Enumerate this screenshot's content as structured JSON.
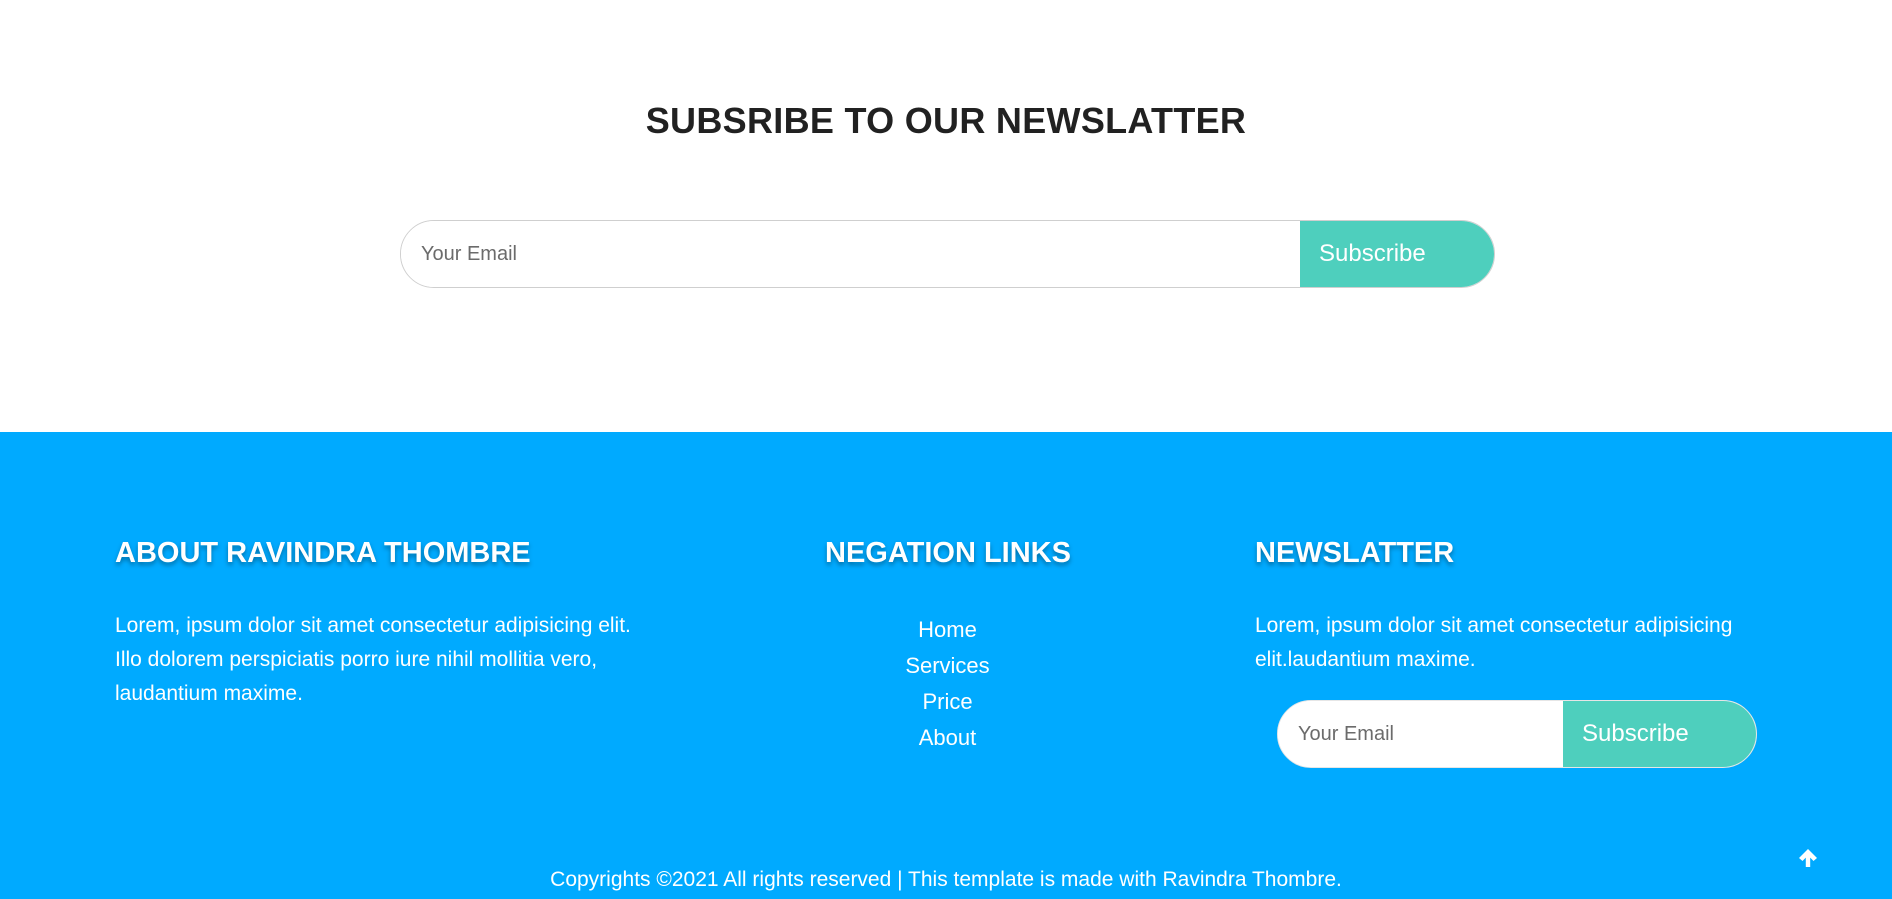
{
  "newsletter": {
    "title": "SUBSRIBE TO OUR NEWSLATTER",
    "email_placeholder": "Your Email",
    "subscribe_label": "Subscribe"
  },
  "footer": {
    "about": {
      "title": "ABOUT RAVINDRA THOMBRE",
      "text": "Lorem, ipsum dolor sit amet consectetur adipisicing elit. Illo dolorem perspiciatis porro iure nihil mollitia vero, laudantium maxime."
    },
    "navigation": {
      "title": "NEGATION LINKS",
      "links": [
        "Home",
        "Services",
        "Price",
        "About"
      ]
    },
    "newsletter": {
      "title": "NEWSLATTER",
      "text": "Lorem, ipsum dolor sit amet consectetur adipisicing elit.laudantium maxime.",
      "email_placeholder": "Your Email",
      "subscribe_label": "Subscribe"
    },
    "copyright": "Copyrights ©2021 All rights reserved | This template is made with Ravindra Thombre.",
    "scroll_top_icon": "arrow-up-icon"
  },
  "colors": {
    "footer_bg": "#00aaff",
    "accent_button": "#4ecfbd",
    "heading_dark": "#212121"
  }
}
